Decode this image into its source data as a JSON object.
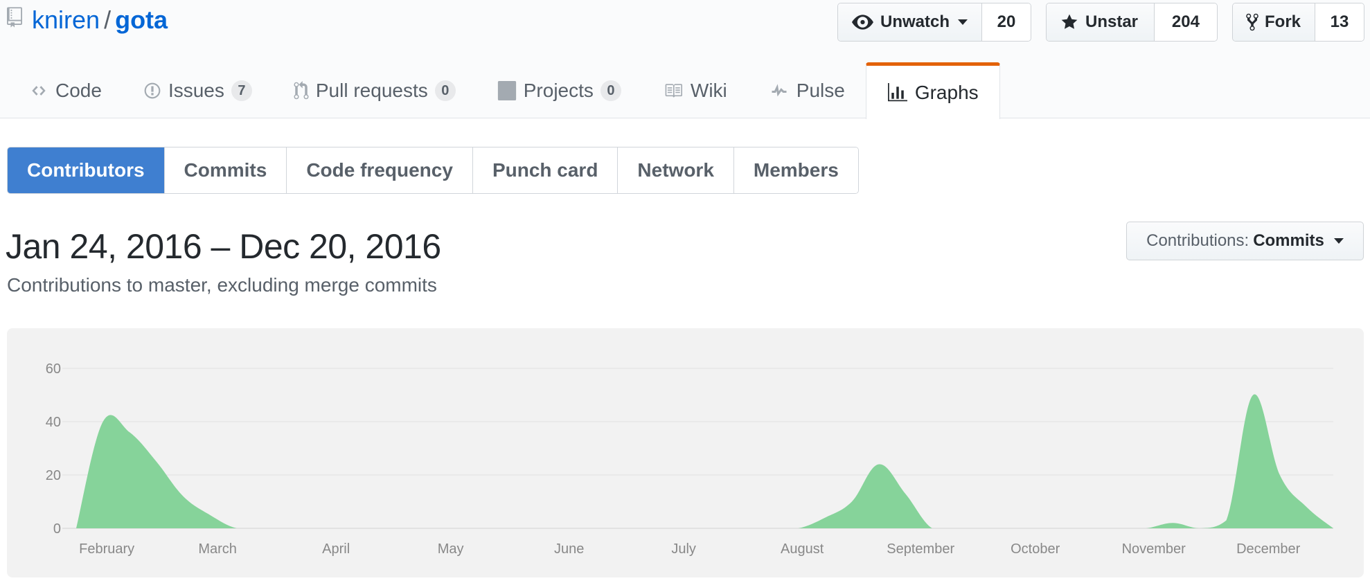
{
  "repo": {
    "owner": "kniren",
    "separator": "/",
    "name": "gota"
  },
  "actions": {
    "watch": {
      "label": "Unwatch",
      "count": "20"
    },
    "star": {
      "label": "Unstar",
      "count": "204"
    },
    "fork": {
      "label": "Fork",
      "count": "13"
    }
  },
  "tabs": [
    {
      "label": "Code",
      "icon": "code-icon"
    },
    {
      "label": "Issues",
      "icon": "issue-opened-icon",
      "count": "7"
    },
    {
      "label": "Pull requests",
      "icon": "git-pull-request-icon",
      "count": "0"
    },
    {
      "label": "Projects",
      "icon": "project-icon",
      "count": "0"
    },
    {
      "label": "Wiki",
      "icon": "book-icon"
    },
    {
      "label": "Pulse",
      "icon": "pulse-icon"
    },
    {
      "label": "Graphs",
      "icon": "graph-icon",
      "selected": true
    }
  ],
  "subnav": [
    "Contributors",
    "Commits",
    "Code frequency",
    "Punch card",
    "Network",
    "Members"
  ],
  "subnav_selected": "Contributors",
  "header": {
    "range": "Jan 24, 2016 – Dec 20, 2016",
    "subtitle": "Contributions to master, excluding merge commits"
  },
  "contributions_select": {
    "prefix": "Contributions:",
    "value": "Commits"
  },
  "colors": {
    "accent": "#e36209",
    "selected_tab_bg": "#3f7fd0",
    "area_fill": "#86d39a",
    "link": "#0366d6"
  },
  "chart_data": {
    "type": "area",
    "title": "",
    "xlabel": "",
    "ylabel": "",
    "ylim": [
      0,
      60
    ],
    "yticks": [
      0,
      20,
      40,
      60
    ],
    "xticks": [
      "February",
      "March",
      "April",
      "May",
      "June",
      "July",
      "August",
      "September",
      "October",
      "November",
      "December"
    ],
    "grid": true,
    "series": [
      {
        "x": [
          "2016-01-24",
          "2016-01-31",
          "2016-02-07",
          "2016-02-14",
          "2016-02-21",
          "2016-02-28",
          "2016-03-06",
          "2016-03-13",
          "2016-03-20",
          "2016-03-27",
          "2016-04-03",
          "2016-04-10",
          "2016-04-17",
          "2016-04-24",
          "2016-05-01",
          "2016-05-08",
          "2016-05-15",
          "2016-05-22",
          "2016-05-29",
          "2016-06-05",
          "2016-06-12",
          "2016-06-19",
          "2016-06-26",
          "2016-07-03",
          "2016-07-10",
          "2016-07-17",
          "2016-07-24",
          "2016-07-31",
          "2016-08-07",
          "2016-08-14",
          "2016-08-21",
          "2016-08-28",
          "2016-09-04",
          "2016-09-11",
          "2016-09-18",
          "2016-09-25",
          "2016-10-02",
          "2016-10-09",
          "2016-10-16",
          "2016-10-23",
          "2016-10-30",
          "2016-11-06",
          "2016-11-13",
          "2016-11-20",
          "2016-11-27",
          "2016-12-04",
          "2016-12-11",
          "2016-12-18"
        ],
        "values": [
          0,
          40,
          36,
          25,
          12,
          5,
          0,
          0,
          0,
          0,
          0,
          0,
          0,
          0,
          0,
          0,
          0,
          0,
          0,
          0,
          0,
          0,
          0,
          0,
          0,
          0,
          0,
          0,
          4,
          10,
          24,
          13,
          0,
          0,
          0,
          0,
          0,
          0,
          0,
          0,
          0,
          2,
          0,
          3,
          50,
          20,
          8,
          0
        ]
      }
    ]
  }
}
